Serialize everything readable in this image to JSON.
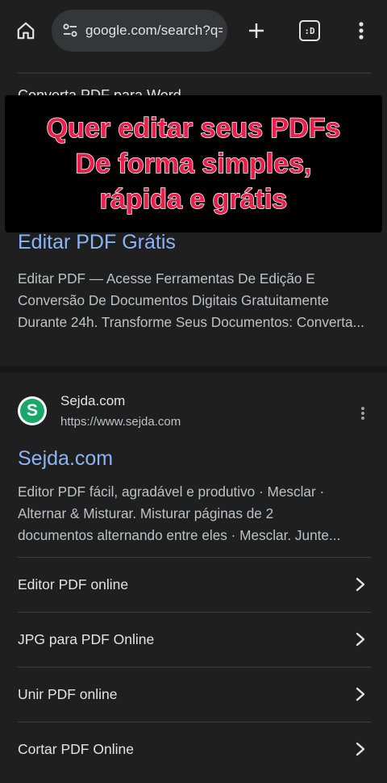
{
  "browser": {
    "url": "google.com/search?q=",
    "tabs_count": ":D"
  },
  "results": {
    "peek_title": "Converta PDF para Word",
    "result1": {
      "title": "Editar PDF Grátis",
      "snippet": "Editar PDF — Acesse Ferramentas De Edição E Conversão De Documentos Digitais Gratuitamente Durante 24h. Transforme Seus Documentos: Converta..."
    },
    "result2": {
      "site_name": "Sejda.com",
      "site_url": "https://www.sejda.com",
      "favicon_letter": "S",
      "title": "Sejda.com",
      "snippet_lines": [
        "Editor PDF fácil, agradável e produtivo · Mesclar ·",
        "Alternar & Misturar. Misturar páginas de 2",
        "documentos alternando entre eles · Mesclar. Junte..."
      ],
      "sitelinks": [
        {
          "label": "Editor PDF online"
        },
        {
          "label": "JPG para PDF Online"
        },
        {
          "label": "Unir PDF online"
        },
        {
          "label": "Cortar PDF Online"
        }
      ]
    }
  },
  "overlay": {
    "lines": [
      "Quer editar seus PDFs",
      "De forma simples,",
      "rápida e grátis"
    ],
    "text_color": "#e91e4a"
  },
  "colors": {
    "background": "#1f1f1f",
    "link": "#8ab4f8",
    "favicon": "#1aa86a"
  }
}
